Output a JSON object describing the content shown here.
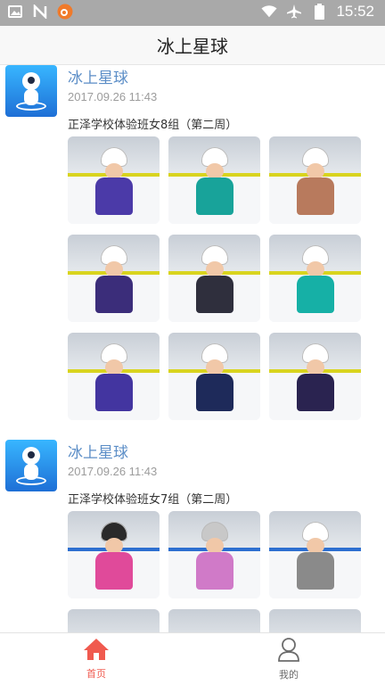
{
  "status_bar": {
    "time": "15:52",
    "left_icons": [
      "image-icon",
      "n-icon",
      "weibo-icon"
    ],
    "right_icons": [
      "wifi-icon",
      "airplane-icon",
      "battery-icon"
    ]
  },
  "header": {
    "title": "冰上星球"
  },
  "posts": [
    {
      "author": "冰上星球",
      "time": "2017.09.26 11:43",
      "desc": "正泽学校体验班女8组（第二周）",
      "photo_count": 9
    },
    {
      "author": "冰上星球",
      "time": "2017.09.26 11:43",
      "desc": "正泽学校体验班女7组（第二周）",
      "photo_count": 6
    }
  ],
  "tabs": [
    {
      "label": "首页",
      "icon": "home-icon",
      "active": true
    },
    {
      "label": "我的",
      "icon": "user-icon",
      "active": false
    }
  ],
  "colors": {
    "accent": "#f05a4f",
    "author": "#5c8ec7",
    "statusbar": "#a9a9a9",
    "inactive_tab": "#6c6c6c"
  }
}
